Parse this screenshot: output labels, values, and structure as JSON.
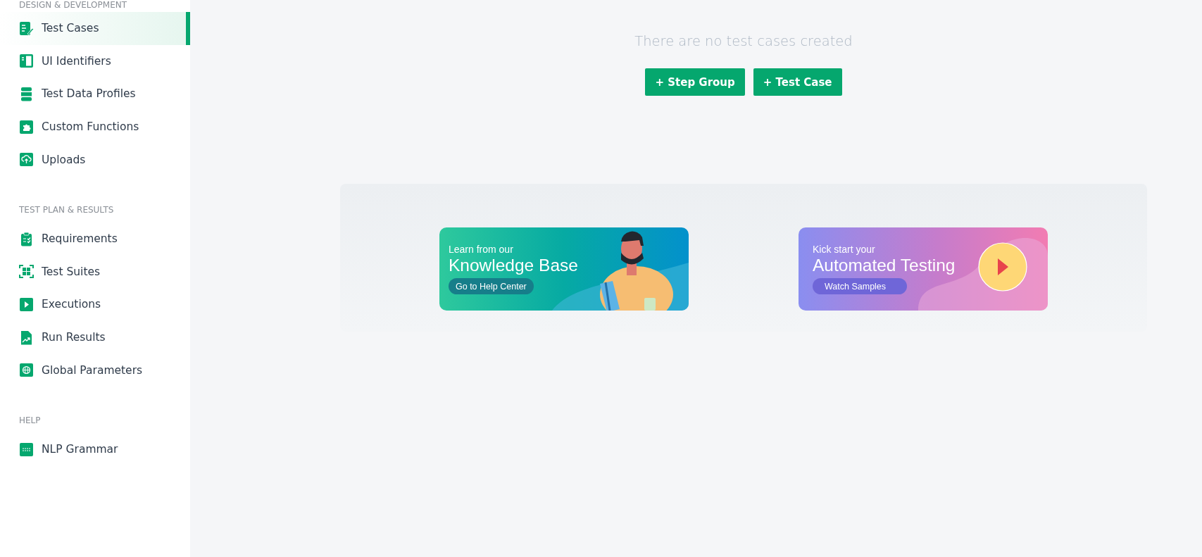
{
  "sidebar": {
    "sections": [
      {
        "heading": "DESIGN & DEVELOPMENT",
        "items": [
          {
            "label": "Test Cases",
            "selected": true
          },
          {
            "label": "UI Identifiers",
            "selected": false
          },
          {
            "label": "Test Data Profiles",
            "selected": false
          },
          {
            "label": "Custom Functions",
            "selected": false
          },
          {
            "label": "Uploads",
            "selected": false
          }
        ]
      },
      {
        "heading": "TEST PLAN & RESULTS",
        "items": [
          {
            "label": "Requirements",
            "selected": false
          },
          {
            "label": "Test Suites",
            "selected": false
          },
          {
            "label": "Executions",
            "selected": false
          },
          {
            "label": "Run Results",
            "selected": false
          },
          {
            "label": "Global Parameters",
            "selected": false
          }
        ]
      },
      {
        "heading": "HELP",
        "items": [
          {
            "label": "NLP Grammar",
            "selected": false
          }
        ]
      }
    ]
  },
  "empty_state": {
    "message": "There are no test cases created",
    "buttons": [
      "+ Step Group",
      "+ Test Case"
    ]
  },
  "banners": [
    {
      "kind": "knowledge",
      "kicker": "Learn from our",
      "title": "Knowledge Base",
      "button": "Go to Help Center"
    },
    {
      "kind": "samples",
      "kicker": "Kick start your",
      "title": "Automated Testing",
      "button": "Watch Samples"
    }
  ]
}
